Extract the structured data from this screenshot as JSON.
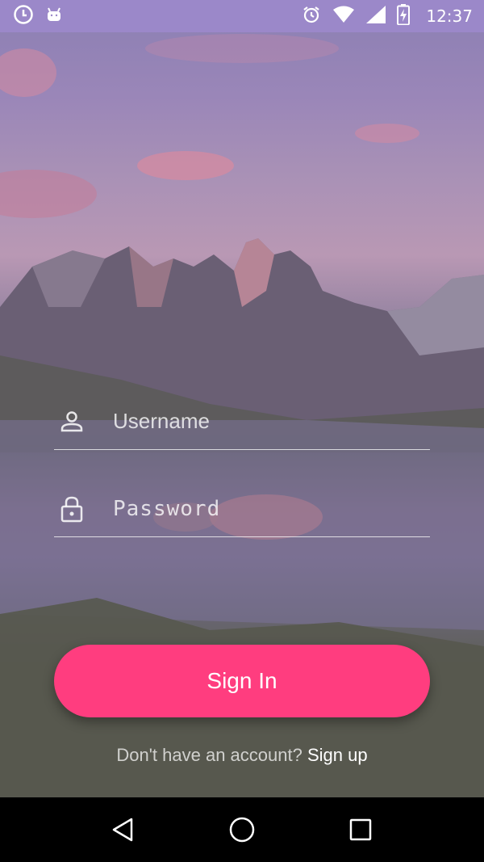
{
  "status_bar": {
    "time": "12:37",
    "background_color": "#9b88c9",
    "left_icons": [
      "clock-icon",
      "android-icon"
    ],
    "right_icons": [
      "alarm-icon",
      "wifi-icon",
      "signal-icon",
      "battery-charging-icon"
    ]
  },
  "login": {
    "username_placeholder": "Username",
    "password_placeholder": "Password",
    "username_icon": "person-icon",
    "password_icon": "lock-icon",
    "signin_label": "Sign In",
    "signin_color": "#ff3d7f",
    "signup_prompt": "Don't have an account?",
    "signup_link": "Sign up"
  },
  "nav_bar": {
    "buttons": [
      "back-icon",
      "home-icon",
      "recents-icon"
    ]
  }
}
